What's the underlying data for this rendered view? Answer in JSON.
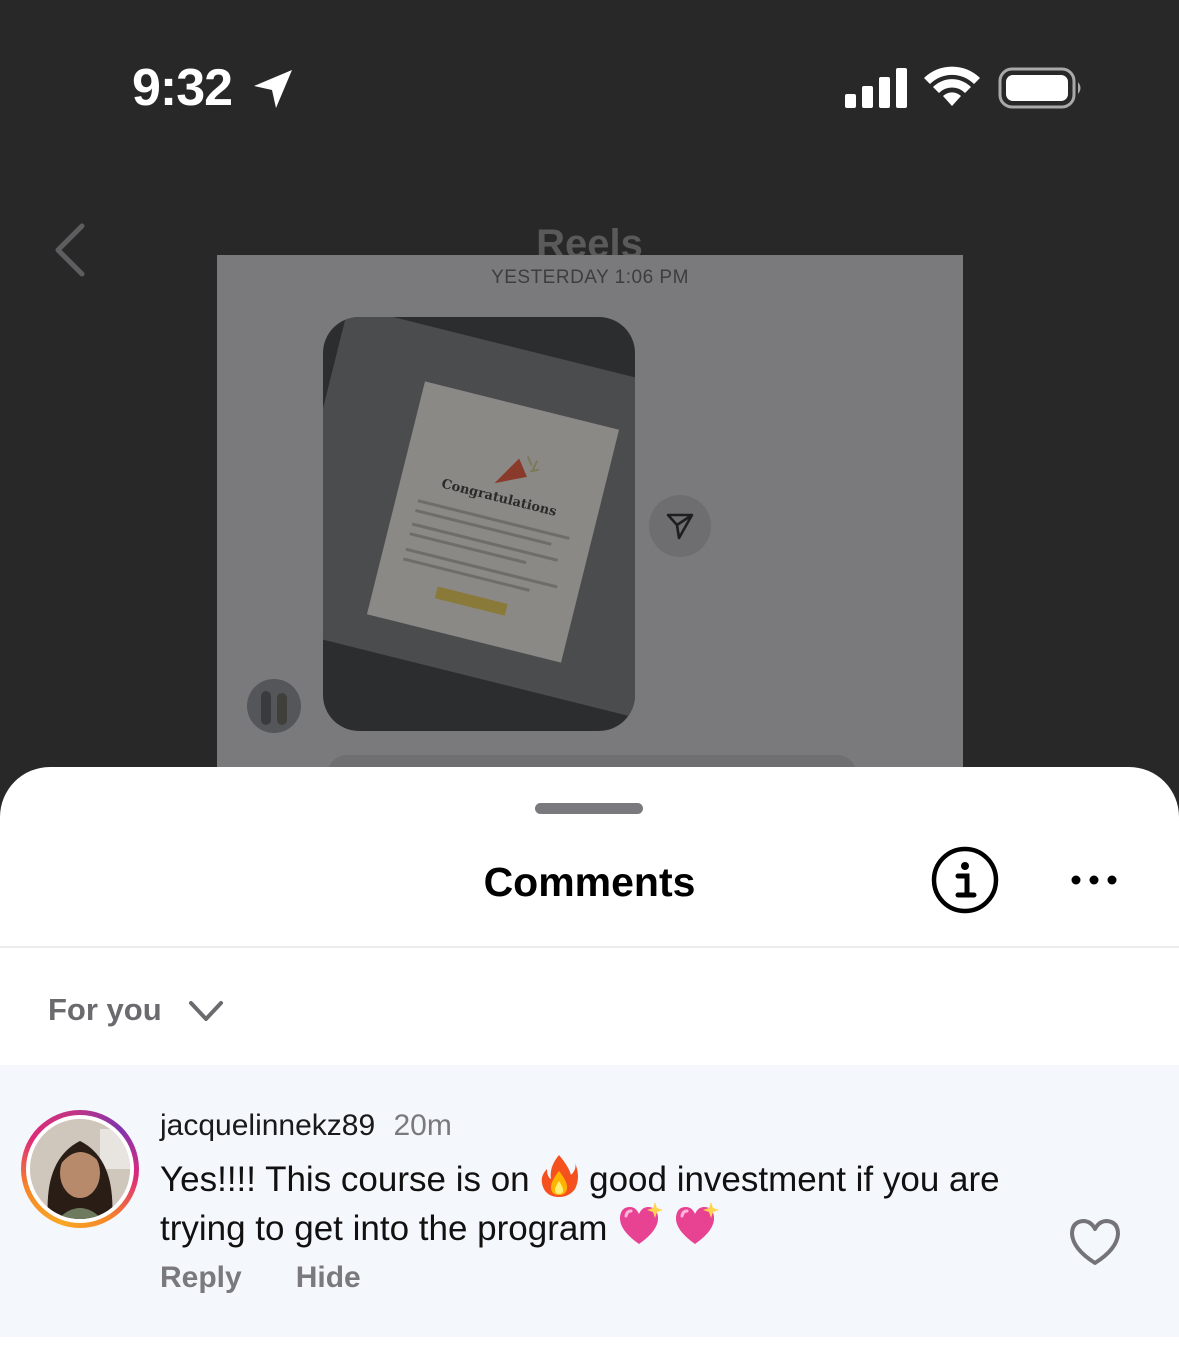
{
  "status_bar": {
    "time": "9:32"
  },
  "background": {
    "title": "Reels",
    "date_label": "YESTERDAY 1:06 PM",
    "reel_dialog_title": "Congratulations"
  },
  "sheet": {
    "title": "Comments",
    "sort_label": "For you"
  },
  "comment": {
    "username": "jacquelinnekz89",
    "time": "20m",
    "text_part1": "Yes!!!! This course is on",
    "text_part2": "good investment if you are trying to get into the program",
    "emojis": [
      "fire",
      "sparkling-heart",
      "sparkling-heart"
    ],
    "reply_label": "Reply",
    "hide_label": "Hide"
  },
  "colors": {
    "sheet_bg": "#ffffff",
    "comment_bg": "#f4f7fb",
    "muted_text": "#7a7a7e",
    "story_ring": [
      "#f9a825",
      "#dd2a7b",
      "#8134af"
    ]
  }
}
